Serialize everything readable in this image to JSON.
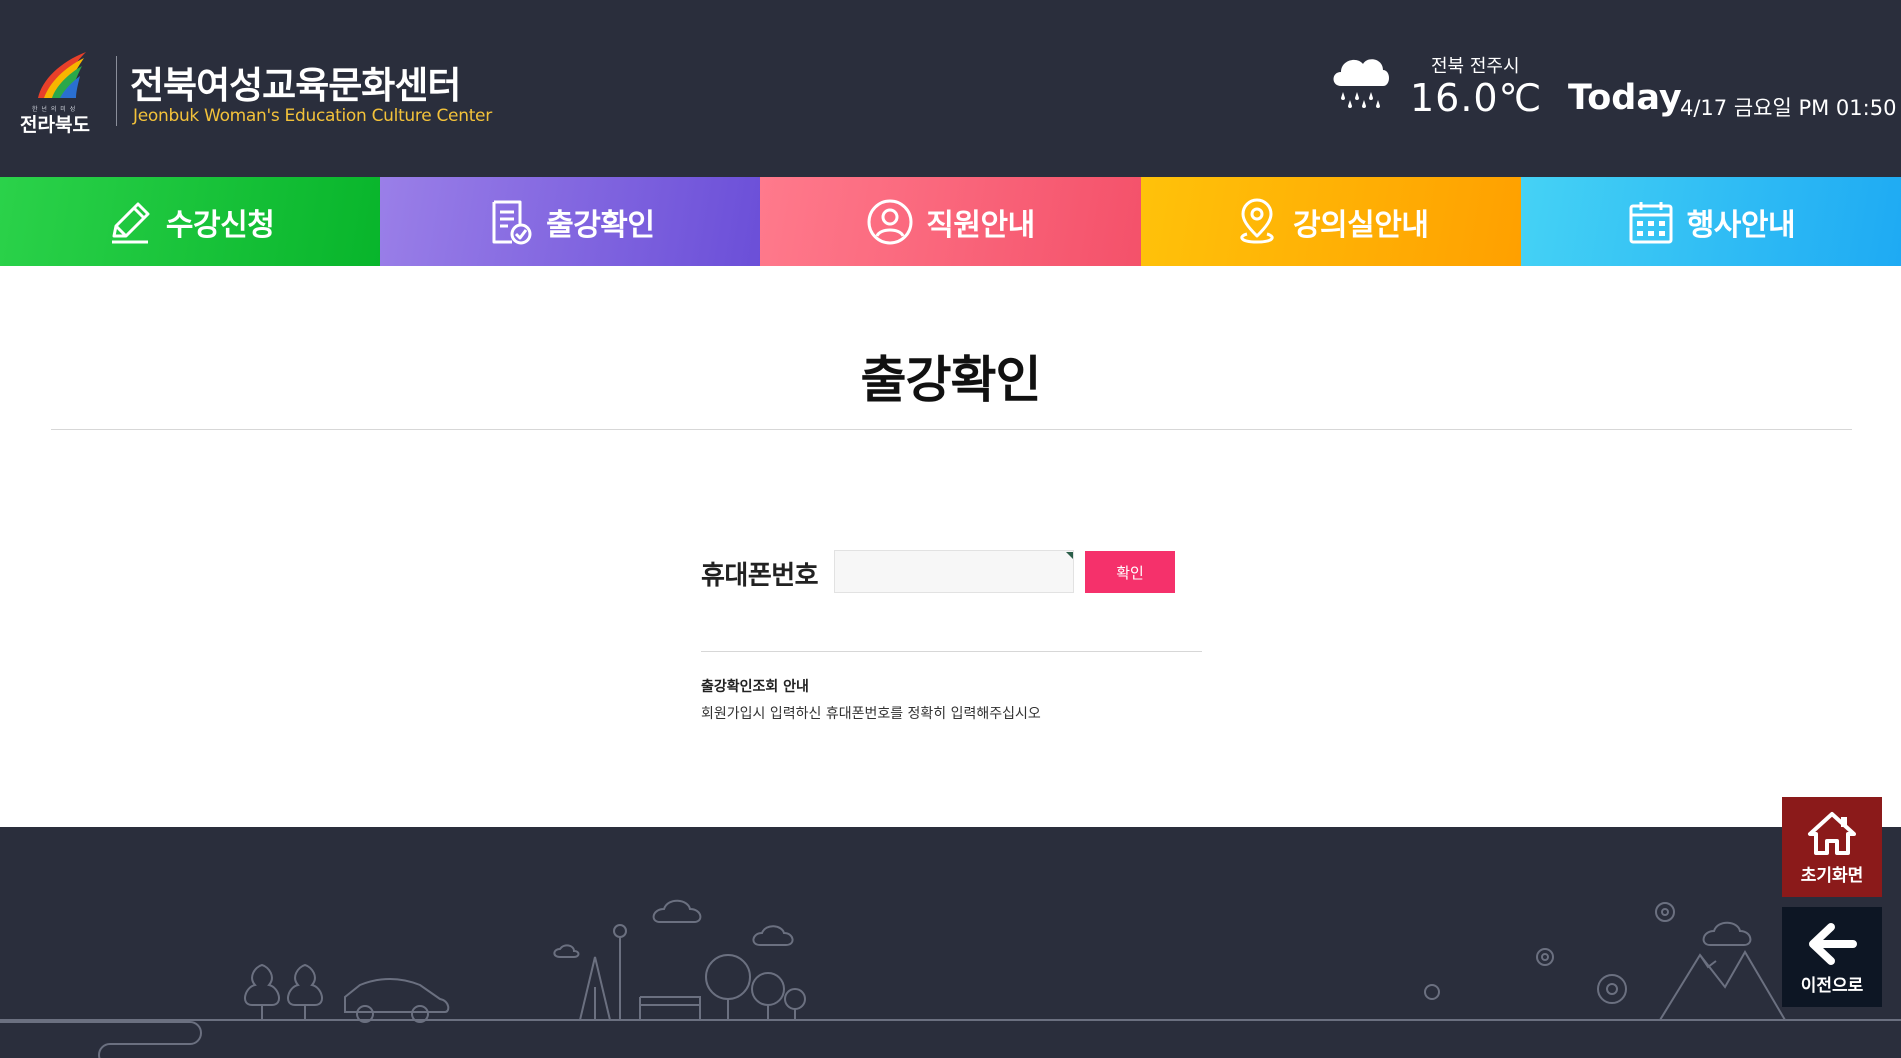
{
  "header": {
    "logo_small_text": "한 넌 의 미 성",
    "logo_text": "전라북도",
    "title": "전북여성교육문화센터",
    "subtitle": "Jeonbuk Woman's Education Culture Center",
    "weather_location": "전북 전주시",
    "temperature": "16.0℃",
    "today_label": "Today",
    "datetime": "4/17 금요일 PM 01:50",
    "weather_icon": "rain-cloud-icon"
  },
  "nav": {
    "items": [
      {
        "label": "수강신청",
        "icon": "pencil-icon",
        "color": "#08b52b"
      },
      {
        "label": "출강확인",
        "icon": "document-check-icon",
        "color": "#6b4fd8"
      },
      {
        "label": "직원안내",
        "icon": "person-icon",
        "color": "#f4516a"
      },
      {
        "label": "강의실안내",
        "icon": "location-pin-icon",
        "color": "#ffa000"
      },
      {
        "label": "행사안내",
        "icon": "calendar-icon",
        "color": "#1eaaf3"
      }
    ]
  },
  "main": {
    "title": "출강확인",
    "form": {
      "label": "휴대폰번호",
      "phone_value": "",
      "phone_placeholder": "",
      "confirm_label": "확인"
    },
    "info": {
      "title": "출강확인조회 안내",
      "text": "회원가입시 입력하신 휴대폰번호를 정확히 입력해주십시오"
    }
  },
  "floating": {
    "home_label": "초기화면",
    "back_label": "이전으로",
    "home_color": "#8b1a1a",
    "back_color": "#0d1624"
  },
  "colors": {
    "header_bg": "#2a2e3c",
    "accent": "#f5316b",
    "subtitle": "#f3c23a"
  }
}
